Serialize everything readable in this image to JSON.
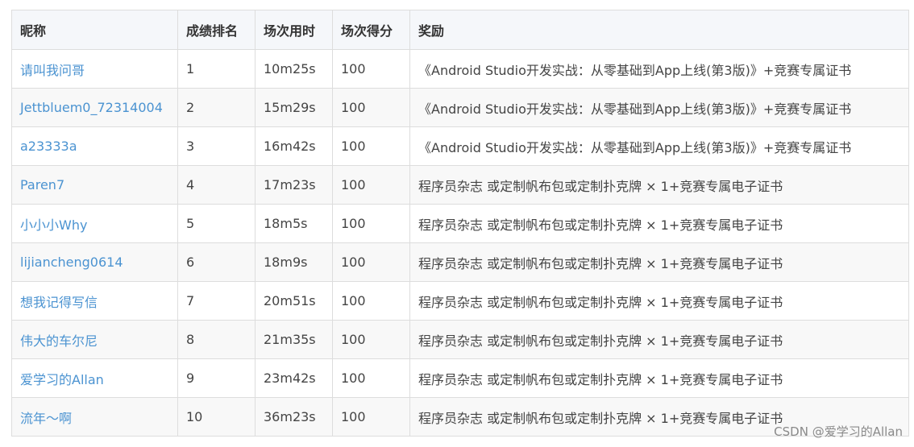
{
  "table": {
    "headers": [
      "昵称",
      "成绩排名",
      "场次用时",
      "场次得分",
      "奖励"
    ],
    "rows": [
      {
        "nickname": "请叫我问哥",
        "rank": "1",
        "time": "10m25s",
        "score": "100",
        "reward": "《Android Studio开发实战：从零基础到App上线(第3版)》+竞赛专属证书"
      },
      {
        "nickname": "Jettbluem0_72314004",
        "rank": "2",
        "time": "15m29s",
        "score": "100",
        "reward": "《Android Studio开发实战：从零基础到App上线(第3版)》+竞赛专属证书"
      },
      {
        "nickname": "a23333a",
        "rank": "3",
        "time": "16m42s",
        "score": "100",
        "reward": "《Android Studio开发实战：从零基础到App上线(第3版)》+竞赛专属证书"
      },
      {
        "nickname": "Paren7",
        "rank": "4",
        "time": "17m23s",
        "score": "100",
        "reward": "程序员杂志 或定制帆布包或定制扑克牌 × 1+竞赛专属电子证书"
      },
      {
        "nickname": "小小小Why",
        "rank": "5",
        "time": "18m5s",
        "score": "100",
        "reward": "程序员杂志 或定制帆布包或定制扑克牌 × 1+竞赛专属电子证书"
      },
      {
        "nickname": "lijiancheng0614",
        "rank": "6",
        "time": "18m9s",
        "score": "100",
        "reward": "程序员杂志 或定制帆布包或定制扑克牌 × 1+竞赛专属电子证书"
      },
      {
        "nickname": "想我记得写信",
        "rank": "7",
        "time": "20m51s",
        "score": "100",
        "reward": "程序员杂志 或定制帆布包或定制扑克牌 × 1+竞赛专属电子证书"
      },
      {
        "nickname": "伟大的车尔尼",
        "rank": "8",
        "time": "21m35s",
        "score": "100",
        "reward": "程序员杂志 或定制帆布包或定制扑克牌 × 1+竞赛专属电子证书"
      },
      {
        "nickname": "爱学习的Allan",
        "rank": "9",
        "time": "23m42s",
        "score": "100",
        "reward": "程序员杂志 或定制帆布包或定制扑克牌 × 1+竞赛专属电子证书"
      },
      {
        "nickname": "流年～啊",
        "rank": "10",
        "time": "36m23s",
        "score": "100",
        "reward": "程序员杂志 或定制帆布包或定制扑克牌 × 1+竞赛专属电子证书"
      }
    ]
  },
  "watermark": "CSDN @爱学习的Allan",
  "colors": {
    "nickname_link": "#4b93d1",
    "header_bg": "#f5f7fa",
    "stripe_bg": "#f8f8f8",
    "border": "#dddddd"
  }
}
